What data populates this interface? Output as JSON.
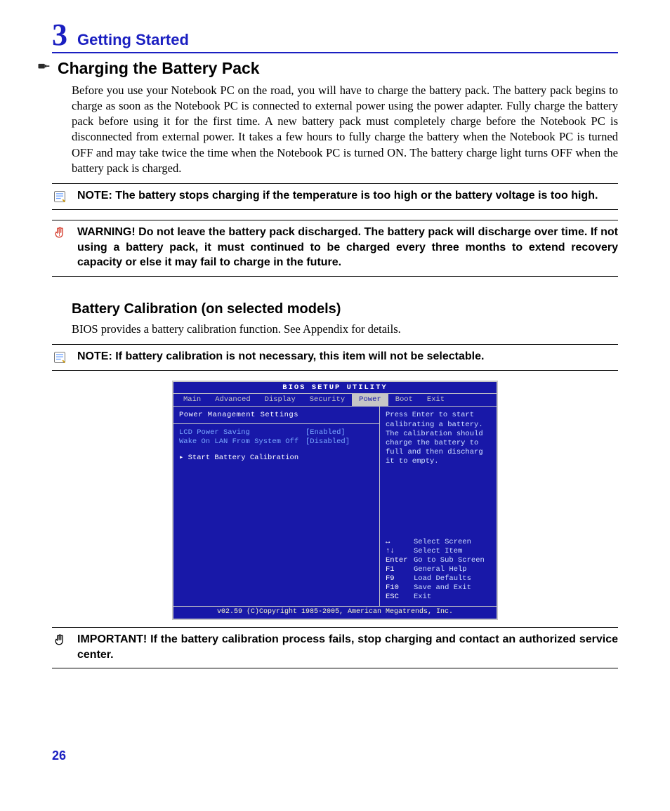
{
  "chapter": {
    "number": "3",
    "title": "Getting Started"
  },
  "section1": {
    "heading": "Charging the Battery Pack",
    "paragraph": "Before you use your Notebook PC on the road, you will have to charge the battery pack. The battery pack begins to charge as soon as the Notebook PC is connected to external power using the power adapter. Fully charge the battery pack before using it for the first time. A new battery pack must completely charge before the Notebook PC is disconnected from external power. It takes a few hours to fully charge the battery when the Notebook PC is turned OFF and may take twice the time when the Notebook PC is turned ON. The battery charge light turns OFF when the battery pack is charged."
  },
  "note1": "NOTE: The battery stops charging if the temperature is too high or the battery voltage is too high.",
  "warning1": "WARNING!  Do not leave the battery pack discharged. The battery pack will discharge over time. If not using a battery pack, it must continued to be charged every three months to extend recovery capacity or else it may fail to charge in the future.",
  "section2": {
    "heading": "Battery Calibration (on selected models)",
    "paragraph": "BIOS provides a battery calibration function. See Appendix for details."
  },
  "note2": "NOTE: If battery calibration is not necessary, this item will not be selectable.",
  "important1": "IMPORTANT!  If the battery calibration process fails, stop charging and contact an authorized service center.",
  "page_number": "26",
  "bios": {
    "title": "BIOS SETUP UTILITY",
    "tabs": [
      "Main",
      "Advanced",
      "Display",
      "Security",
      "Power",
      "Boot",
      "Exit"
    ],
    "active_tab": "Power",
    "section_head": "Power Management Settings",
    "items": [
      {
        "key": "LCD Power Saving",
        "value": "[Enabled]"
      },
      {
        "key": "Wake On LAN From System Off",
        "value": "[Disabled]"
      }
    ],
    "selected": "▸ Start Battery Calibration",
    "help": "Press Enter to start calibrating a battery. The calibration should charge the battery to full and then discharg it to empty.",
    "keys": [
      {
        "k": "↔",
        "d": "Select Screen"
      },
      {
        "k": "↑↓",
        "d": "Select Item"
      },
      {
        "k": "Enter",
        "d": "Go to Sub Screen"
      },
      {
        "k": "F1",
        "d": "General Help"
      },
      {
        "k": "F9",
        "d": "Load Defaults"
      },
      {
        "k": "F10",
        "d": "Save and Exit"
      },
      {
        "k": "ESC",
        "d": "Exit"
      }
    ],
    "footer": "v02.59 (C)Copyright 1985-2005, American Megatrends, Inc."
  }
}
